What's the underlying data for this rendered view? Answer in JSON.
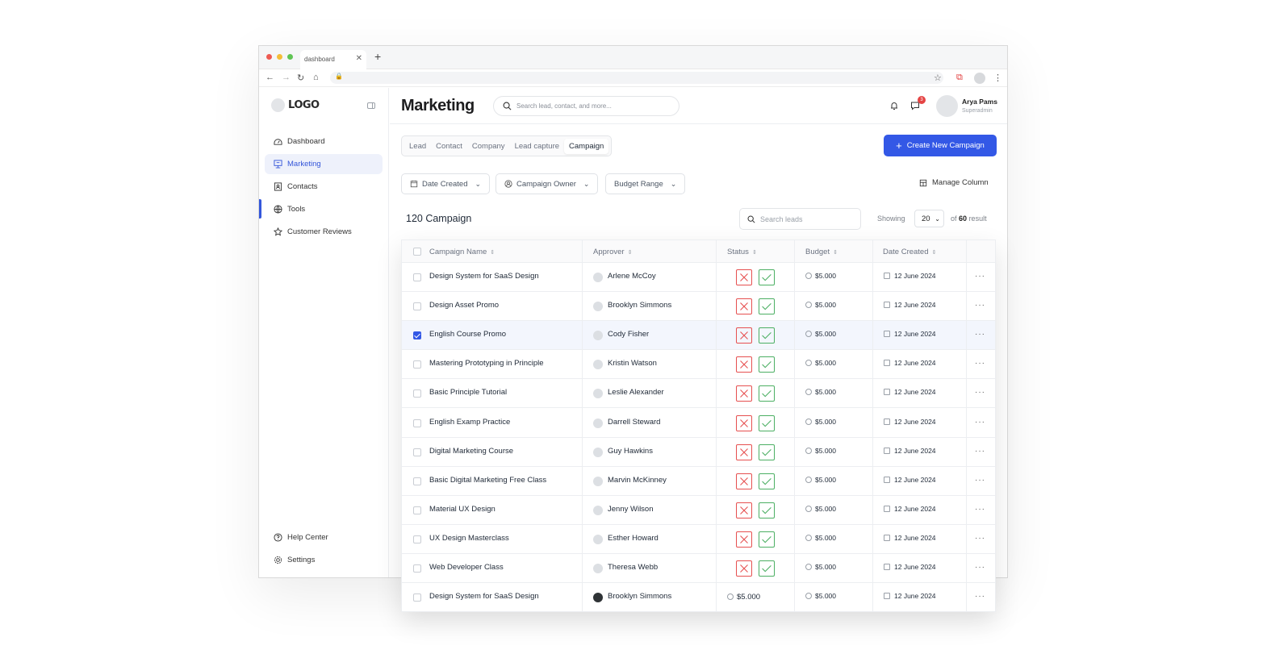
{
  "browser": {
    "tab_title": "dashboard"
  },
  "sidebar": {
    "logo": "LOGO",
    "items": [
      {
        "label": "Dashboard",
        "icon": "dashboard-icon"
      },
      {
        "label": "Marketing",
        "icon": "marketing-icon"
      },
      {
        "label": "Contacts",
        "icon": "contacts-icon"
      },
      {
        "label": "Tools",
        "icon": "tools-icon"
      },
      {
        "label": "Customer Reviews",
        "icon": "star-icon"
      }
    ],
    "bottom": [
      {
        "label": "Help Center",
        "icon": "help-icon"
      },
      {
        "label": "Settings",
        "icon": "gear-icon"
      }
    ]
  },
  "header": {
    "title": "Marketing",
    "search_placeholder": "Search lead, contact, and more...",
    "notification_count": "3",
    "user_name": "Arya Pams",
    "user_role": "Superadmin"
  },
  "tabs": [
    "Lead",
    "Contact",
    "Company",
    "Lead capture",
    "Campaign"
  ],
  "create_button": "Create New Campaign",
  "filters": [
    "Date Created",
    "Campaign Owner",
    "Budget Range"
  ],
  "manage_column": "Manage Column",
  "list": {
    "count_label": "120 Campaign",
    "search_placeholder": "Search leads",
    "showing_label": "Showing",
    "page_size": "20",
    "of_label": "of",
    "total": "60",
    "result_label": "result"
  },
  "table": {
    "columns": [
      "Campaign Name",
      "Approver",
      "Status",
      "Budget",
      "Date Created"
    ],
    "rows": [
      {
        "name": "Design System for SaaS Design",
        "approver": "Arlene McCoy",
        "budget": "$5.000",
        "date": "12 June 2024",
        "checked": false
      },
      {
        "name": "Design Asset Promo",
        "approver": "Brooklyn Simmons",
        "budget": "$5.000",
        "date": "12 June 2024",
        "checked": false
      },
      {
        "name": "English Course Promo",
        "approver": "Cody Fisher",
        "budget": "$5.000",
        "date": "12 June 2024",
        "checked": true
      },
      {
        "name": "Mastering Prototyping in Principle",
        "approver": "Kristin Watson",
        "budget": "$5.000",
        "date": "12 June 2024",
        "checked": false
      },
      {
        "name": "Basic Principle Tutorial",
        "approver": "Leslie Alexander",
        "budget": "$5.000",
        "date": "12 June 2024",
        "checked": false
      },
      {
        "name": "English Examp Practice",
        "approver": "Darrell Steward",
        "budget": "$5.000",
        "date": "12 June 2024",
        "checked": false
      },
      {
        "name": "Digital Marketing Course",
        "approver": "Guy Hawkins",
        "budget": "$5.000",
        "date": "12 June 2024",
        "checked": false
      },
      {
        "name": "Basic Digital Marketing Free Class",
        "approver": "Marvin McKinney",
        "budget": "$5.000",
        "date": "12 June 2024",
        "checked": false
      },
      {
        "name": "Material UX Design",
        "approver": "Jenny Wilson",
        "budget": "$5.000",
        "date": "12 June 2024",
        "checked": false
      },
      {
        "name": "UX Design Masterclass",
        "approver": "Esther Howard",
        "budget": "$5.000",
        "date": "12 June 2024",
        "checked": false
      },
      {
        "name": "Web Developer Class",
        "approver": "Theresa Webb",
        "budget": "$5.000",
        "date": "12 June 2024",
        "checked": false
      },
      {
        "name": "Design System for SaaS Design",
        "approver": "Brooklyn Simmons",
        "status_text": "$5.000",
        "budget": "$5.000",
        "date": "12 June 2024",
        "checked": false
      }
    ]
  }
}
